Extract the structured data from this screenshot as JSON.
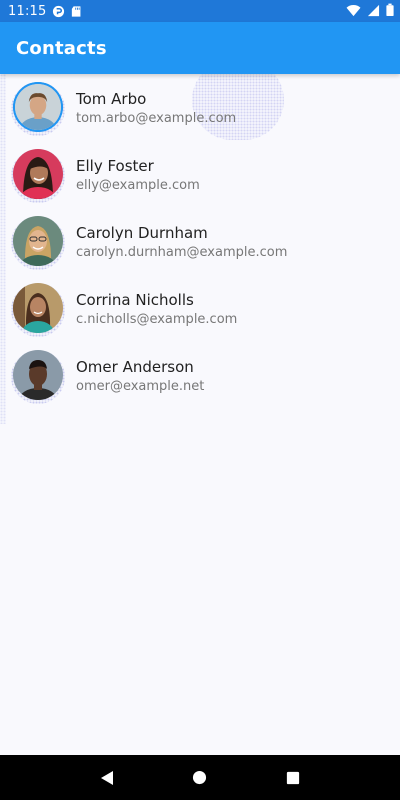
{
  "status_bar": {
    "time": "11:15"
  },
  "app_bar": {
    "title": "Contacts"
  },
  "contacts": [
    {
      "name": "Tom Arbo",
      "email": "tom.arbo@example.com",
      "skin": "#d4a685",
      "hair": "#6b4a2e",
      "shirt": "#6aa0c8",
      "bg": "#c9d3d8"
    },
    {
      "name": "Elly Foster",
      "email": "elly@example.com",
      "skin": "#b07a5a",
      "hair": "#2a1a14",
      "shirt": "#e03055",
      "bg": "#d63b5d"
    },
    {
      "name": "Carolyn Durnham",
      "email": "carolyn.durnham@example.com",
      "skin": "#e2b58f",
      "hair": "#c9a464",
      "shirt": "#3e6a5a",
      "bg": "#6b8a7d"
    },
    {
      "name": "Corrina Nicholls",
      "email": "c.nicholls@example.com",
      "skin": "#b88463",
      "hair": "#4a2e1e",
      "shirt": "#2aa6a0",
      "bg": "#b89a6a"
    },
    {
      "name": "Omer Anderson",
      "email": "omer@example.net",
      "skin": "#5a3a2a",
      "hair": "#1a1210",
      "shirt": "#2a2a2a",
      "bg": "#8a9aa8"
    }
  ],
  "colors": {
    "status_bar": "#1f78d8",
    "app_bar": "#2196f3",
    "background": "#f9f9fd",
    "nav_bar": "#000000"
  }
}
